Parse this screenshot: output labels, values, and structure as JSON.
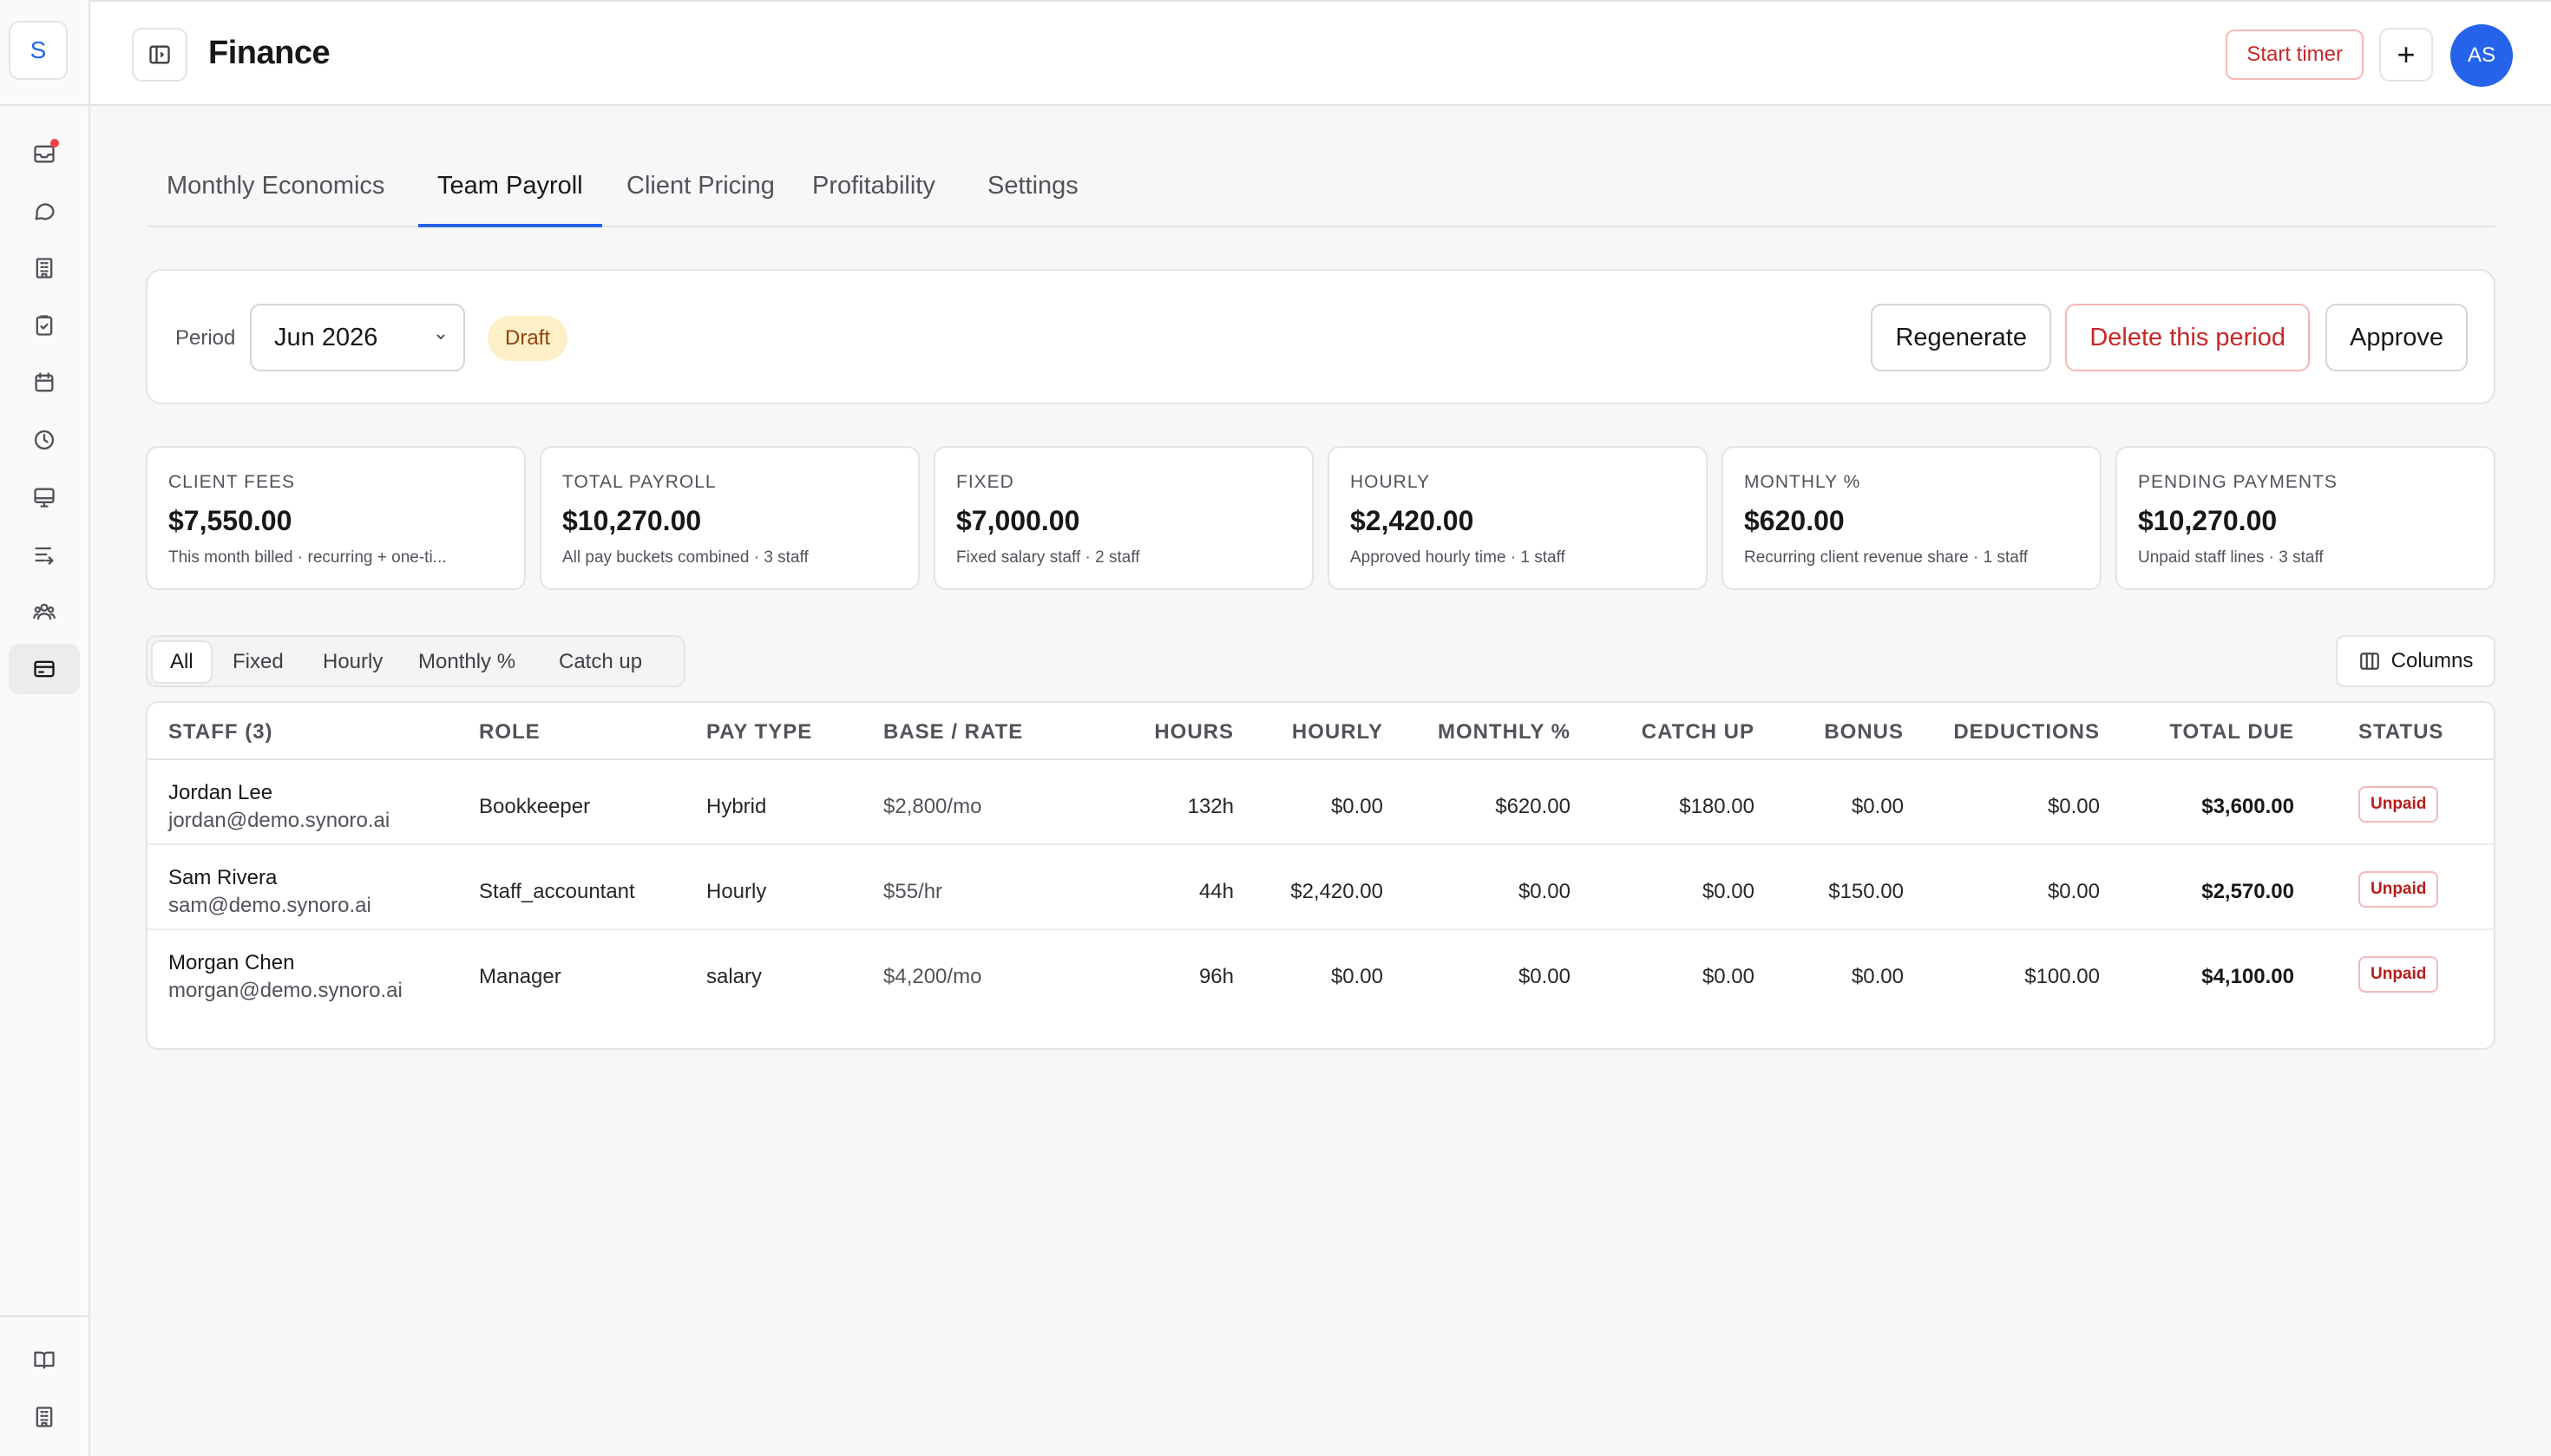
{
  "sidebar": {
    "logo_letter": "S",
    "items": [
      {
        "icon": "inbox-icon"
      },
      {
        "icon": "chat-icon"
      },
      {
        "icon": "building-icon"
      },
      {
        "icon": "clipboard-check-icon"
      },
      {
        "icon": "calendar-icon"
      },
      {
        "icon": "clock-icon"
      },
      {
        "icon": "monitor-icon"
      },
      {
        "icon": "list-arrow-icon"
      },
      {
        "icon": "team-icon"
      },
      {
        "icon": "credit-card-icon",
        "active": true
      }
    ],
    "bottom_items": [
      {
        "icon": "book-icon"
      },
      {
        "icon": "building-icon"
      }
    ]
  },
  "header": {
    "title": "Finance",
    "start_timer_label": "Start timer",
    "plus_label": "+",
    "avatar_initials": "AS"
  },
  "tabs": [
    {
      "label": "Monthly Economics"
    },
    {
      "label": "Team Payroll",
      "active": true
    },
    {
      "label": "Client Pricing"
    },
    {
      "label": "Profitability"
    },
    {
      "label": "Settings"
    }
  ],
  "period": {
    "label": "Period",
    "selected": "Jun 2026",
    "status_badge": "Draft",
    "regenerate_label": "Regenerate",
    "delete_label": "Delete this period",
    "approve_label": "Approve"
  },
  "stats": [
    {
      "label": "CLIENT FEES",
      "value": "$7,550.00",
      "sub": "This month billed · recurring + one-ti..."
    },
    {
      "label": "TOTAL PAYROLL",
      "value": "$10,270.00",
      "sub": "All pay buckets combined · 3 staff"
    },
    {
      "label": "FIXED",
      "value": "$7,000.00",
      "sub": "Fixed salary staff · 2 staff"
    },
    {
      "label": "HOURLY",
      "value": "$2,420.00",
      "sub": "Approved hourly time · 1 staff"
    },
    {
      "label": "MONTHLY %",
      "value": "$620.00",
      "sub": "Recurring client revenue share · 1 staff"
    },
    {
      "label": "PENDING PAYMENTS",
      "value": "$10,270.00",
      "sub": "Unpaid staff lines · 3 staff"
    }
  ],
  "filters": {
    "options": [
      "All",
      "Fixed",
      "Hourly",
      "Monthly %",
      "Catch up"
    ],
    "active": "All",
    "columns_label": "Columns"
  },
  "table": {
    "headers": {
      "staff": "STAFF (3)",
      "role": "ROLE",
      "pay_type": "PAY TYPE",
      "base_rate": "BASE / RATE",
      "hours": "HOURS",
      "hourly": "HOURLY",
      "monthly_pct": "MONTHLY %",
      "catch_up": "CATCH UP",
      "bonus": "BONUS",
      "deductions": "DEDUCTIONS",
      "total_due": "TOTAL DUE",
      "status": "STATUS"
    },
    "rows": [
      {
        "name": "Jordan Lee",
        "email": "jordan@demo.synoro.ai",
        "role": "Bookkeeper",
        "pay_type": "Hybrid",
        "base_rate": "$2,800/mo",
        "hours": "132h",
        "hourly": "$0.00",
        "monthly_pct": "$620.00",
        "catch_up": "$180.00",
        "bonus": "$0.00",
        "deductions": "$0.00",
        "total_due": "$3,600.00",
        "status": "Unpaid"
      },
      {
        "name": "Sam Rivera",
        "email": "sam@demo.synoro.ai",
        "role": "Staff_accountant",
        "pay_type": "Hourly",
        "base_rate": "$55/hr",
        "hours": "44h",
        "hourly": "$2,420.00",
        "monthly_pct": "$0.00",
        "catch_up": "$0.00",
        "bonus": "$150.00",
        "deductions": "$0.00",
        "total_due": "$2,570.00",
        "status": "Unpaid"
      },
      {
        "name": "Morgan Chen",
        "email": "morgan@demo.synoro.ai",
        "role": "Manager",
        "pay_type": "salary",
        "base_rate": "$4,200/mo",
        "hours": "96h",
        "hourly": "$0.00",
        "monthly_pct": "$0.00",
        "catch_up": "$0.00",
        "bonus": "$0.00",
        "deductions": "$100.00",
        "total_due": "$4,100.00",
        "status": "Unpaid"
      }
    ]
  },
  "colors": {
    "accent": "#2563eb",
    "danger": "#c62828",
    "draft_bg": "#fdf0c8",
    "draft_text": "#92400e"
  }
}
